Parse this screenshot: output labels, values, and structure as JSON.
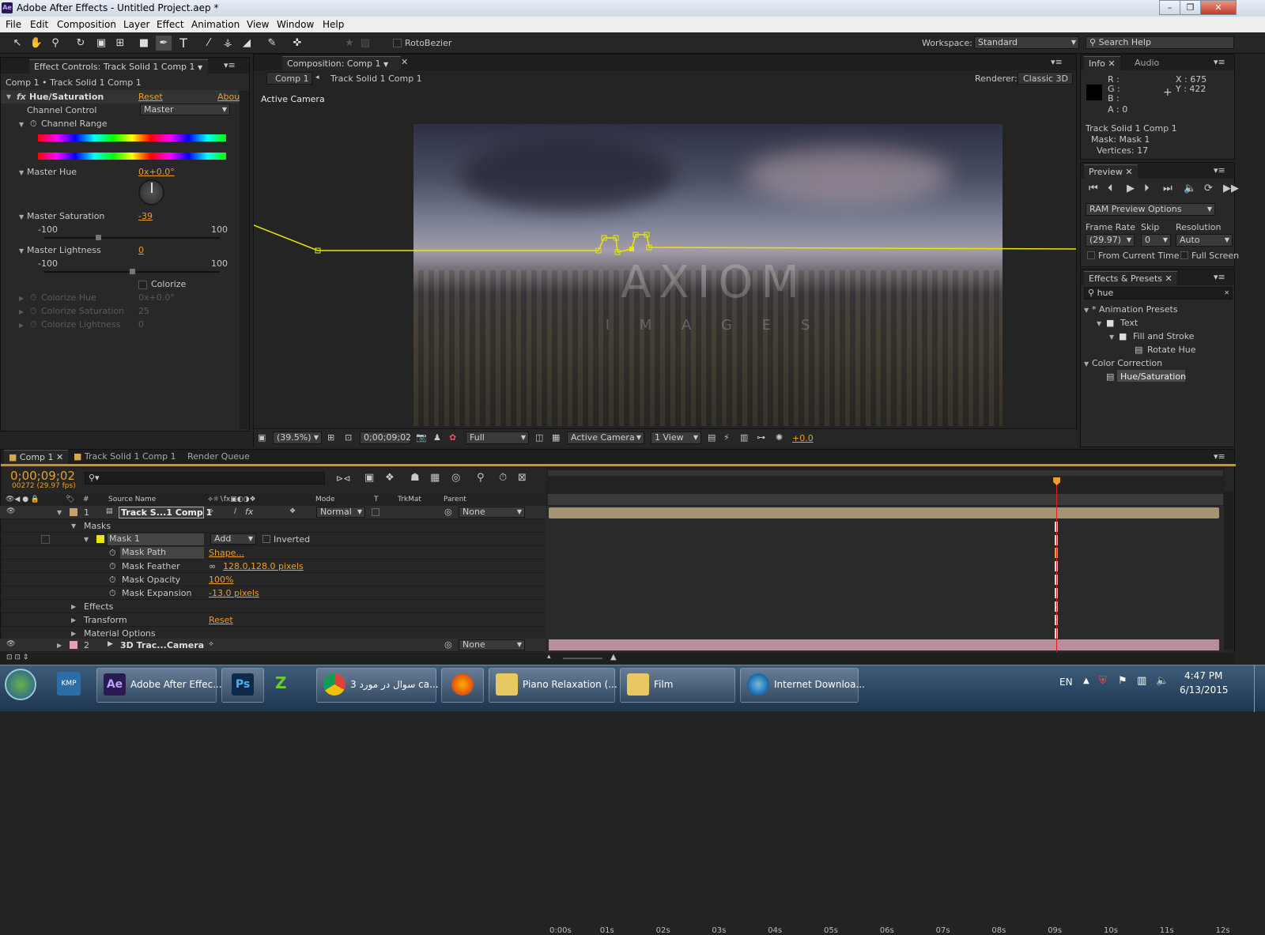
{
  "window": {
    "title": "Adobe After Effects - Untitled Project.aep *",
    "logo": "Ae"
  },
  "menu": [
    "File",
    "Edit",
    "Composition",
    "Layer",
    "Effect",
    "Animation",
    "View",
    "Window",
    "Help"
  ],
  "toolbar": {
    "rotobezier_label": "RotoBezier",
    "workspace_label": "Workspace:",
    "workspace_value": "Standard",
    "search_placeholder": "Search Help"
  },
  "effect_controls": {
    "tab": "Effect Controls: Track Solid 1 Comp 1",
    "breadcrumb": "Comp 1 • Track Solid 1 Comp 1",
    "effect_name": "Hue/Saturation",
    "reset": "Reset",
    "about": "Abou",
    "channel_control_label": "Channel Control",
    "channel_control_value": "Master",
    "channel_range_label": "Channel Range",
    "master_hue_label": "Master Hue",
    "master_hue_value": "0x+0.0°",
    "master_saturation_label": "Master Saturation",
    "master_saturation_value": "-39",
    "master_saturation_level": -39,
    "master_lightness_label": "Master Lightness",
    "master_lightness_value": "0",
    "master_lightness_level": 0,
    "range_min": "-100",
    "range_max": "100",
    "colorize_label": "Colorize",
    "colorize_hue_label": "Colorize Hue",
    "colorize_hue_value": "0x+0.0°",
    "colorize_saturation_label": "Colorize Saturation",
    "colorize_saturation_value": "25",
    "colorize_lightness_label": "Colorize Lightness",
    "colorize_lightness_value": "0"
  },
  "composition": {
    "tab": "Composition: Comp 1",
    "nav_comp": "Comp 1",
    "nav_layer": "Track Solid 1 Comp 1",
    "renderer_label": "Renderer:",
    "renderer_value": "Classic 3D",
    "active_camera_label": "Active Camera",
    "watermark_main": "AXIOM",
    "watermark_sub": "I M A G E S",
    "zoom": "(39.5%)",
    "timecode": "0;00;09;02",
    "resolution": "Full",
    "view_camera": "Active Camera",
    "view_count": "1 View",
    "exposure": "+0.0"
  },
  "info": {
    "tab_info": "Info",
    "tab_audio": "Audio",
    "r": "R :",
    "g": "G :",
    "b": "B :",
    "a": "A : 0",
    "x": "X : 675",
    "y": "Y : 422",
    "layer": "Track Solid 1 Comp 1",
    "mask": "Mask: Mask 1",
    "vertices": "Vertices: 17"
  },
  "preview": {
    "tab": "Preview",
    "ram_options": "RAM Preview Options",
    "frame_rate_label": "Frame Rate",
    "skip_label": "Skip",
    "resolution_label": "Resolution",
    "frame_rate_value": "(29.97)",
    "skip_value": "0",
    "resolution_value": "Auto",
    "from_current": "From Current Time",
    "full_screen": "Full Screen"
  },
  "effects_presets": {
    "tab": "Effects & Presets",
    "search": "hue",
    "tree": [
      {
        "label": "* Animation Presets",
        "indent": 0
      },
      {
        "label": "Text",
        "indent": 1
      },
      {
        "label": "Fill and Stroke",
        "indent": 2
      },
      {
        "label": "Rotate Hue",
        "indent": 3
      },
      {
        "label": "Color Correction",
        "indent": 0
      },
      {
        "label": "Hue/Saturation",
        "indent": 1
      }
    ]
  },
  "timeline": {
    "tabs": [
      "Comp 1",
      "Track Solid 1 Comp 1",
      "Render Queue"
    ],
    "timecode": "0;00;09;02",
    "frames": "00272 (29.97 fps)",
    "col_num": "#",
    "col_source": "Source Name",
    "col_mode": "Mode",
    "col_t": "T",
    "col_trkmat": "TrkMat",
    "col_parent": "Parent",
    "ruler": [
      "0:00s",
      "01s",
      "02s",
      "03s",
      "04s",
      "05s",
      "06s",
      "07s",
      "08s",
      "09s",
      "10s",
      "11s",
      "12s"
    ],
    "playhead_seconds": 9.07,
    "layer1": {
      "num": "1",
      "name": "Track S...1 Comp 1",
      "mode": "Normal",
      "parent": "None"
    },
    "masks_label": "Masks",
    "mask1": {
      "name": "Mask 1",
      "mode": "Add",
      "inverted": "Inverted"
    },
    "props": [
      {
        "label": "Mask Path",
        "value": "Shape..."
      },
      {
        "label": "Mask Feather",
        "value": "128.0,128.0 pixels"
      },
      {
        "label": "Mask Opacity",
        "value": "100%"
      },
      {
        "label": "Mask Expansion",
        "value": "-13.0 pixels"
      }
    ],
    "groups": [
      {
        "label": "Effects",
        "value": ""
      },
      {
        "label": "Transform",
        "value": "Reset"
      },
      {
        "label": "Material Options",
        "value": ""
      }
    ],
    "layer2": {
      "num": "2",
      "name": "3D Trac...Camera",
      "parent": "None"
    }
  },
  "taskbar": {
    "apps": [
      {
        "label": "Adobe After Effec...",
        "icon": "Ae"
      },
      {
        "label": "",
        "icon": "Ps"
      },
      {
        "label": "سوال در مورد 3 ca...",
        "icon": "chrome"
      },
      {
        "label": "",
        "icon": "firefox"
      },
      {
        "label": "Piano Relaxation (...",
        "icon": "folder"
      },
      {
        "label": "Film",
        "icon": "folder"
      },
      {
        "label": "Internet Downloa...",
        "icon": "idm"
      }
    ],
    "lang": "EN",
    "time": "4:47 PM",
    "date": "6/13/2015"
  },
  "colors": {
    "accent": "#e8a030",
    "mask": "#e8e800",
    "playhead": "#e02020"
  }
}
